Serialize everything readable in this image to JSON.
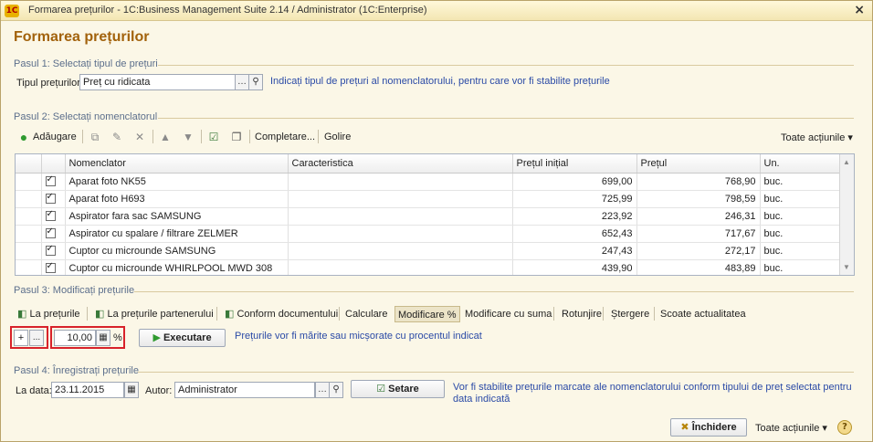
{
  "window": {
    "title": "Formarea prețurilor - 1C:Business Management Suite 2.14 / Administrator  (1C:Enterprise)",
    "logo": "1C",
    "close": "×"
  },
  "form_title": "Formarea prețurilor",
  "step1": {
    "section": "Pasul 1: Selectați tipul de prețuri",
    "label": "Tipul prețurilor:",
    "value": "Preț cu ridicata",
    "hint": "Indicați tipul de prețuri al nomenclatorului, pentru care vor fi stabilite prețurile"
  },
  "step2": {
    "section": "Pasul 2: Selectați nomenclatorul",
    "toolbar": {
      "add": "Adăugare",
      "complete": "Completare...",
      "clear": "Golire",
      "all_actions": "Toate acțiunile"
    },
    "columns": [
      "",
      "",
      "Nomenclator",
      "Caracteristica",
      "Prețul inițial",
      "Prețul",
      "Un."
    ],
    "rows": [
      {
        "name": "Aparat foto NK55",
        "char": "",
        "initial": "699,00",
        "price": "768,90",
        "unit": "buc."
      },
      {
        "name": "Aparat foto H693",
        "char": "",
        "initial": "725,99",
        "price": "798,59",
        "unit": "buc."
      },
      {
        "name": "Aspirator  fara sac SAMSUNG",
        "char": "",
        "initial": "223,92",
        "price": "246,31",
        "unit": "buc."
      },
      {
        "name": "Aspirator cu spalare / filtrare ZELMER",
        "char": "",
        "initial": "652,43",
        "price": "717,67",
        "unit": "buc."
      },
      {
        "name": "Cuptor cu microunde SAMSUNG",
        "char": "",
        "initial": "247,43",
        "price": "272,17",
        "unit": "buc."
      },
      {
        "name": "Cuptor cu microunde WHIRLPOOL MWD 308",
        "char": "",
        "initial": "439,90",
        "price": "483,89",
        "unit": "buc."
      }
    ]
  },
  "step3": {
    "section": "Pasul 3: Modificați prețurile",
    "tabs": [
      "La prețurile",
      "La prețurile partenerului",
      "Conform documentului",
      "Calculare",
      "Modificare %",
      "Modificare cu suma",
      "Rotunjire",
      "Ștergere",
      "Scoate actualitatea"
    ],
    "sign": "+",
    "dots": "...",
    "percent_value": "10,00",
    "percent_unit": "%",
    "execute": "Executare",
    "hint": "Prețurile vor fi mărite sau micșorate cu procentul indicat"
  },
  "step4": {
    "section": "Pasul 4: Înregistrați prețurile",
    "date_label": "La data:",
    "date_value": "23.11.2015",
    "author_label": "Autor:",
    "author_value": "Administrator",
    "set_button": "Setare",
    "hint_line1": "Vor fi stabilite prețurile marcate ale nomenclatorului conform tipului de preț selectat pentru",
    "hint_line2": "data indicată"
  },
  "footer": {
    "close": "Închidere",
    "all_actions": "Toate acțiunile",
    "help": "?"
  },
  "colors": {
    "title_accent": "#a2620c",
    "hint_blue": "#2a4aa6",
    "highlight_red": "#d8222a",
    "window_bg": "#fbf7e7"
  }
}
